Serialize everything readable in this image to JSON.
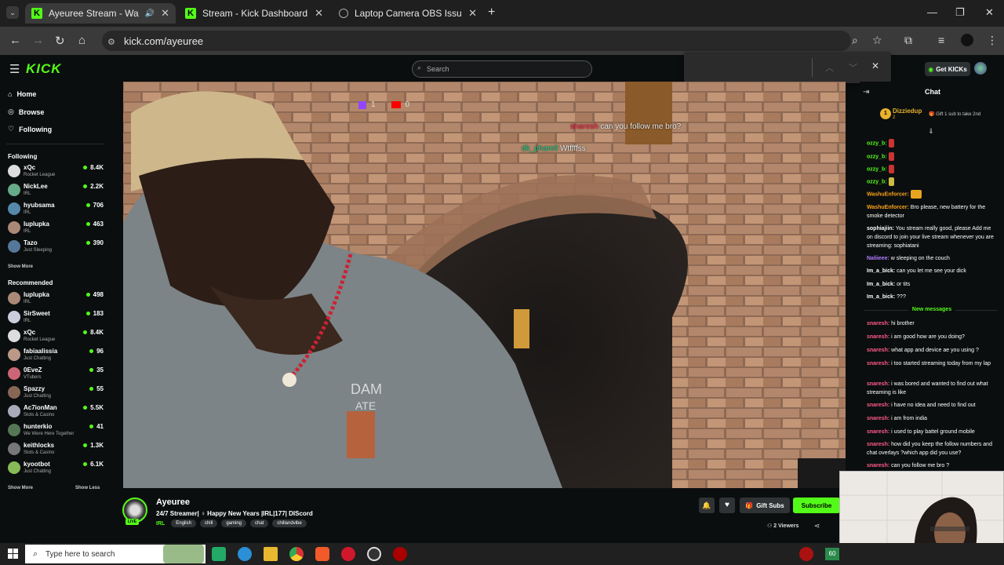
{
  "browser": {
    "tabs": [
      {
        "title": "Ayeuree Stream - Watch Live on K",
        "active": true
      },
      {
        "title": "Stream - Kick Dashboard",
        "active": false
      },
      {
        "title": "Laptop Camera OBS Issue",
        "active": false
      }
    ],
    "url": "kick.com/ayeuree"
  },
  "header": {
    "logo": "KICK",
    "search_placeholder": "Search",
    "get_kicks": "Get KICKs"
  },
  "sidebar": {
    "nav": [
      {
        "label": "Home",
        "icon": "home-icon"
      },
      {
        "label": "Browse",
        "icon": "compass-icon"
      },
      {
        "label": "Following",
        "icon": "heart-icon"
      }
    ],
    "following_title": "Following",
    "following": [
      {
        "name": "xQc",
        "category": "Rocket League",
        "viewers": "8.4K",
        "color": "#ddd"
      },
      {
        "name": "NickLee",
        "category": "IRL",
        "viewers": "2.2K",
        "color": "#6a8"
      },
      {
        "name": "hyubsama",
        "category": "IRL",
        "viewers": "706",
        "color": "#58a"
      },
      {
        "name": "luplupka",
        "category": "IRL",
        "viewers": "463",
        "color": "#a87"
      },
      {
        "name": "Tazo",
        "category": "Just Sleeping",
        "viewers": "390",
        "color": "#579"
      }
    ],
    "show_more": "Show More",
    "recommended_title": "Recommended",
    "recommended": [
      {
        "name": "luplupka",
        "category": "IRL",
        "viewers": "498",
        "color": "#a87"
      },
      {
        "name": "SirSweet",
        "category": "IRL",
        "viewers": "183",
        "color": "#ccd"
      },
      {
        "name": "xQc",
        "category": "Rocket League",
        "viewers": "8.4K",
        "color": "#ddd"
      },
      {
        "name": "fabiaalissia",
        "category": "Just Chatting",
        "viewers": "96",
        "color": "#b98"
      },
      {
        "name": "0EveZ",
        "category": "VTubers",
        "viewers": "35",
        "color": "#c67"
      },
      {
        "name": "Spazzy",
        "category": "Just Chatting",
        "viewers": "55",
        "color": "#865"
      },
      {
        "name": "Ac7ionMan",
        "category": "Slots & Casino",
        "viewers": "5.5K",
        "color": "#aab"
      },
      {
        "name": "hunterkio",
        "category": "We Were Here Together",
        "viewers": "41",
        "color": "#575"
      },
      {
        "name": "keithlocks",
        "category": "Slots & Casino",
        "viewers": "1.3K",
        "color": "#777"
      },
      {
        "name": "kyootbot",
        "category": "Just Chatting",
        "viewers": "6.1K",
        "color": "#8b5"
      }
    ],
    "show_less": "Show Less"
  },
  "video": {
    "overlay_twitch": "1",
    "overlay_yt": "0",
    "overlay_chat1_user": "snaresh",
    "overlay_chat1": "can you follow me bro?",
    "overlay_chat2_user": "dk_pharell",
    "overlay_chat2": "Wtffffss"
  },
  "stream": {
    "streamer": "Ayeuree",
    "live": "LIVE",
    "title": "24/7 Streamer| ♀ Happy New Years |IRL|177| DIScord",
    "category": "IRL",
    "tags": [
      "English",
      "chill",
      "gaming",
      "chat",
      "chillandvibe"
    ],
    "gift_subs": "Gift Subs",
    "subscribe": "Subscribe",
    "viewers": "2 Viewers"
  },
  "chat": {
    "title": "Chat",
    "pinned_rank": "1",
    "pinned_user": "Dizziedup",
    "pinned_count": "2",
    "pinned_text": "Gift 1 sub to take 2nd",
    "new_messages": "New messages",
    "messages": [
      {
        "user": "ozzy_b",
        "text": "",
        "color": "#53fc18",
        "emote": "#c33"
      },
      {
        "user": "ozzy_b",
        "text": "",
        "color": "#53fc18",
        "emote": "#c33"
      },
      {
        "user": "ozzy_b",
        "text": "",
        "color": "#53fc18",
        "emote": "#c33"
      },
      {
        "user": "ozzy_b",
        "text": "",
        "color": "#53fc18",
        "emote": "#cb4"
      },
      {
        "user": "WashuEnforcer",
        "text": "",
        "color": "#f6a21a",
        "emote": "#e9a41f"
      },
      {
        "user": "WashuEnforcer",
        "text": "Bro please, new battery for the smoke detector",
        "color": "#f6a21a"
      },
      {
        "user": "sophiajiin",
        "text": "You stream really good, please Add me on discord to join your live stream whenever you are streaming: sophiatani",
        "color": "#fff"
      },
      {
        "user": "Naliieee",
        "text": "w sleeping on the couch",
        "color": "#b07cff"
      },
      {
        "user": "Im_a_bick",
        "text": "can you let me see your dick",
        "color": "#fff"
      },
      {
        "user": "Im_a_bick",
        "text": "or tits",
        "color": "#fff"
      },
      {
        "user": "Im_a_bick",
        "text": "???",
        "color": "#fff"
      },
      {
        "user": "snaresh",
        "text": "hi brother",
        "color": "#ff5c8a"
      },
      {
        "user": "snaresh",
        "text": "i am good how are you doing?",
        "color": "#ff5c8a"
      },
      {
        "user": "snaresh",
        "text": "what app and device ae you using ?",
        "color": "#ff5c8a"
      },
      {
        "user": "snaresh",
        "text": "i too started streaming today from my lap",
        "color": "#ff5c8a"
      },
      {
        "user": "snaresh",
        "text": "i was bored and wanted to find out what streaming is like",
        "color": "#ff5c8a"
      },
      {
        "user": "snaresh",
        "text": "i have no idea and need to find out",
        "color": "#ff5c8a"
      },
      {
        "user": "snaresh",
        "text": "i am from india",
        "color": "#ff5c8a"
      },
      {
        "user": "snaresh",
        "text": "i used to play battel ground mobile",
        "color": "#ff5c8a"
      },
      {
        "user": "snaresh",
        "text": "how did you keep the follow numbers and chat overlays ?which app did you use?",
        "color": "#ff5c8a"
      },
      {
        "user": "snaresh",
        "text": "can you follow me bro ?",
        "color": "#ff5c8a"
      }
    ]
  },
  "taskbar": {
    "search_placeholder": "Type here to search",
    "badge": "60"
  }
}
